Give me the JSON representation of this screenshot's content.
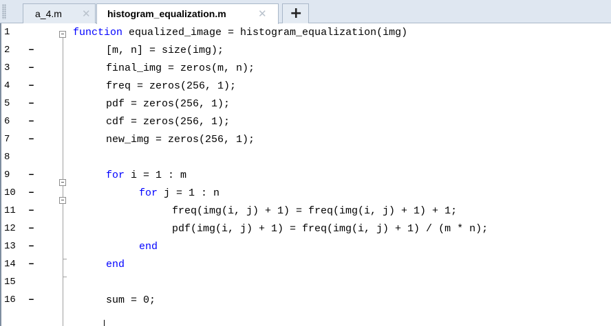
{
  "tabs": [
    {
      "label": "a_4.m",
      "close": "✕",
      "active": false
    },
    {
      "label": "histogram_equalization.m",
      "close": "✕",
      "active": true
    }
  ],
  "new_tab_symbol": "+",
  "colors": {
    "keyword": "#0000ff",
    "text": "#000000",
    "tab_bar": "#dfe7f1"
  },
  "lines": [
    {
      "num": "1",
      "dash": "",
      "code": [
        {
          "t": "function",
          "kw": true
        },
        {
          "t": " equalized_image = histogram_equalization(img)"
        }
      ]
    },
    {
      "num": "2",
      "dash": "–",
      "code": [
        {
          "t": "[m, n] = size(img);"
        }
      ]
    },
    {
      "num": "3",
      "dash": "–",
      "code": [
        {
          "t": "final_img = zeros(m, n);"
        }
      ]
    },
    {
      "num": "4",
      "dash": "–",
      "code": [
        {
          "t": "freq = zeros(256, 1);"
        }
      ]
    },
    {
      "num": "5",
      "dash": "–",
      "code": [
        {
          "t": "pdf = zeros(256, 1);"
        }
      ]
    },
    {
      "num": "6",
      "dash": "–",
      "code": [
        {
          "t": "cdf = zeros(256, 1);"
        }
      ]
    },
    {
      "num": "7",
      "dash": "–",
      "code": [
        {
          "t": "new_img = zeros(256, 1);"
        }
      ]
    },
    {
      "num": "8",
      "dash": "",
      "code": []
    },
    {
      "num": "9",
      "dash": "–",
      "code": [
        {
          "t": "for",
          "kw": true
        },
        {
          "t": " i = 1 : m"
        }
      ]
    },
    {
      "num": "10",
      "dash": "–",
      "code": [
        {
          "t": "for",
          "kw": true
        },
        {
          "t": " j = 1 : n"
        }
      ]
    },
    {
      "num": "11",
      "dash": "–",
      "code": [
        {
          "t": "freq(img(i, j) + 1) = freq(img(i, j) + 1) + 1;"
        }
      ]
    },
    {
      "num": "12",
      "dash": "–",
      "code": [
        {
          "t": "pdf(img(i, j) + 1) = freq(img(i, j) + 1) / (m * n);"
        }
      ]
    },
    {
      "num": "13",
      "dash": "–",
      "code": [
        {
          "t": "end",
          "kw": true
        }
      ]
    },
    {
      "num": "14",
      "dash": "–",
      "code": [
        {
          "t": "end",
          "kw": true
        }
      ]
    },
    {
      "num": "15",
      "dash": "",
      "code": []
    },
    {
      "num": "16",
      "dash": "–",
      "code": [
        {
          "t": "sum = 0;"
        }
      ]
    }
  ]
}
